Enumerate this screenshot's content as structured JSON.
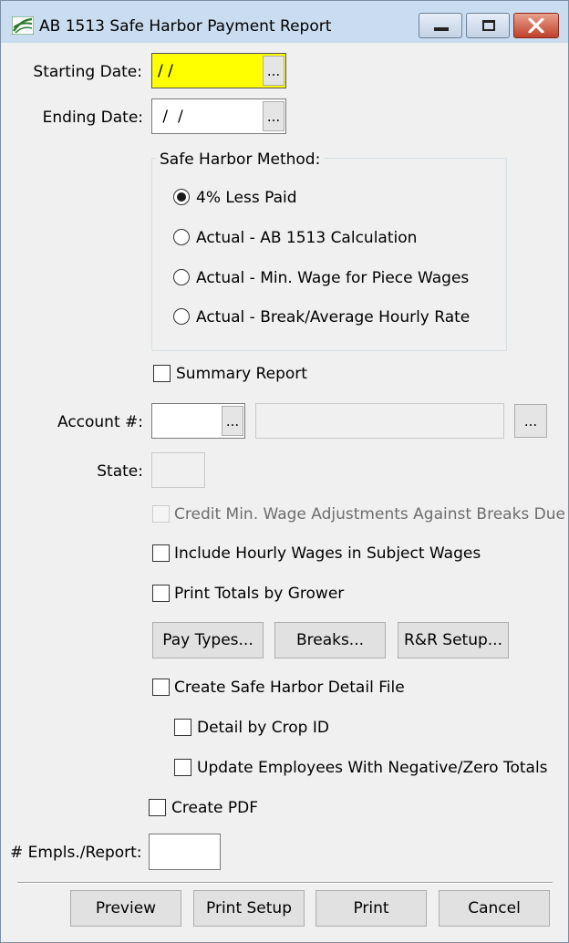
{
  "window": {
    "title": "AB 1513 Safe Harbor Payment Report"
  },
  "form": {
    "starting_date_label": "Starting Date:",
    "starting_date_value": "/ /",
    "ending_date_label": "Ending Date:",
    "ending_date_value": " /  /",
    "browse_label": "...",
    "method_group_label": "Safe Harbor Method:",
    "methods": [
      {
        "label": "4% Less Paid",
        "selected": true
      },
      {
        "label": "Actual - AB 1513 Calculation",
        "selected": false
      },
      {
        "label": "Actual - Min. Wage for Piece Wages",
        "selected": false
      },
      {
        "label": "Actual - Break/Average Hourly Rate",
        "selected": false
      }
    ],
    "summary_report_label": "Summary Report",
    "account_label": "Account #:",
    "account_value": "",
    "account_name_value": "",
    "state_label": "State:",
    "state_value": "",
    "credit_min_wage_label": "Credit Min. Wage Adjustments Against Breaks Due",
    "include_hourly_label": "Include Hourly Wages in Subject Wages",
    "print_totals_label": "Print Totals by Grower",
    "pay_types_button": "Pay Types...",
    "breaks_button": "Breaks...",
    "rr_setup_button": "R&R Setup...",
    "create_detail_file_label": "Create Safe Harbor Detail File",
    "detail_by_crop_label": "Detail by Crop ID",
    "update_employees_label": "Update Employees With Negative/Zero Totals",
    "create_pdf_label": "Create PDF",
    "empls_per_report_label": "# Empls./Report:",
    "empls_per_report_value": ""
  },
  "footer": {
    "preview_button": "Preview",
    "print_setup_button": "Print Setup",
    "print_button": "Print",
    "cancel_button": "Cancel"
  },
  "colors": {
    "required_field": "#ffff00",
    "titlebar": "#c9dcf0",
    "close_button": "#c0412a"
  }
}
